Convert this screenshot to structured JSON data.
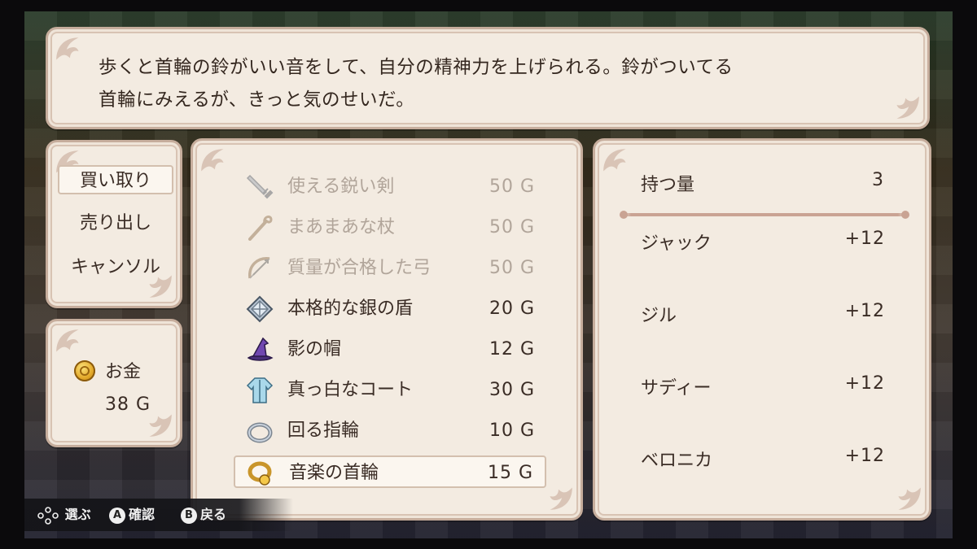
{
  "description": {
    "line1": "歩くと首輪の鈴がいい音をして、自分の精神力を上げられる。鈴がついてる",
    "line2": "首輪にみえるが、きっと気のせいだ。"
  },
  "commands": [
    {
      "label": "買い取り",
      "selected": true
    },
    {
      "label": "売り出し",
      "selected": false
    },
    {
      "label": "キャンソル",
      "selected": false
    }
  ],
  "money": {
    "label": "お金",
    "amount": "38 G",
    "icon": "gold-coin-icon"
  },
  "items": [
    {
      "name": "使える鋭い剣",
      "price": "50 G",
      "icon": "sword-icon",
      "available": false
    },
    {
      "name": "まあまあな杖",
      "price": "50 G",
      "icon": "staff-icon",
      "available": false
    },
    {
      "name": "質量が合格した弓",
      "price": "50 G",
      "icon": "bow-icon",
      "available": false
    },
    {
      "name": "本格的な銀の盾",
      "price": "20 G",
      "icon": "silver-shield-icon",
      "available": true
    },
    {
      "name": "影の帽",
      "price": "12 G",
      "icon": "wizard-hat-icon",
      "available": true
    },
    {
      "name": "真っ白なコート",
      "price": "30 G",
      "icon": "coat-icon",
      "available": true
    },
    {
      "name": "回る指輪",
      "price": "10 G",
      "icon": "ring-icon",
      "available": true
    },
    {
      "name": "音楽の首輪",
      "price": "15 G",
      "icon": "collar-icon",
      "available": true,
      "selected": true
    }
  ],
  "party": {
    "hold_label": "持つ量",
    "hold_value": "3",
    "members": [
      {
        "name": "ジャック",
        "value": "+12"
      },
      {
        "name": "ジル",
        "value": "+12"
      },
      {
        "name": "サディー",
        "value": "+12"
      },
      {
        "name": "ベロニカ",
        "value": "+12"
      }
    ]
  },
  "hint": {
    "dpad_icon": "dpad-icon",
    "select_label": "選ぶ",
    "a_glyph": "A",
    "confirm_label": "確認",
    "b_glyph": "B",
    "back_label": "戻る"
  }
}
